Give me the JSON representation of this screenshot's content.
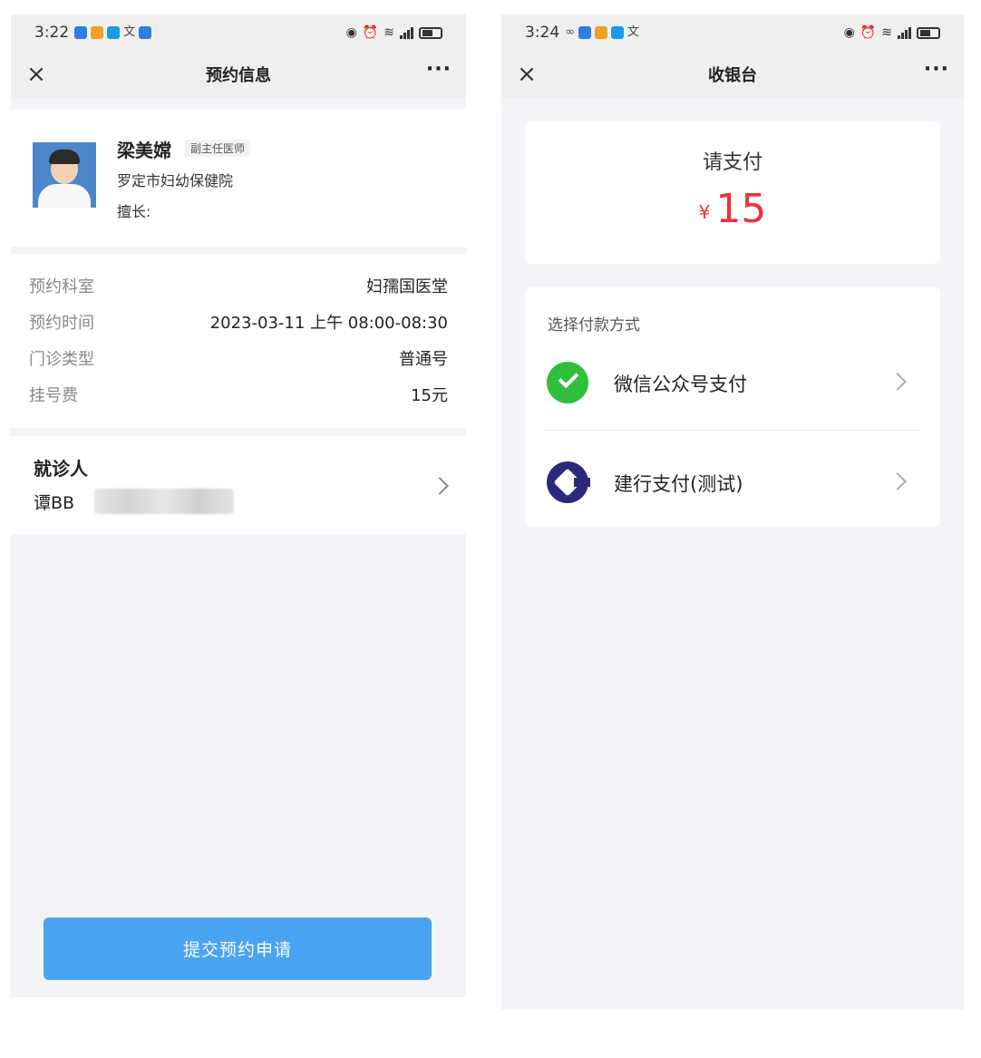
{
  "left": {
    "status": {
      "time": "3:22"
    },
    "navbar": {
      "title": "预约信息",
      "more": "···"
    },
    "doctor": {
      "name": "梁美嫦",
      "title": "副主任医师",
      "hospital": "罗定市妇幼保健院",
      "specialty": "擅长:"
    },
    "info": [
      {
        "label": "预约科室",
        "value": "妇孺国医堂"
      },
      {
        "label": "预约时间",
        "value": "2023-03-11 上午 08:00-08:30"
      },
      {
        "label": "门诊类型",
        "value": "普通号"
      },
      {
        "label": "挂号费",
        "value": "15元"
      }
    ],
    "patient": {
      "heading": "就诊人",
      "name": "谭BB"
    },
    "submit_label": "提交预约申请"
  },
  "right": {
    "status": {
      "time": "3:24"
    },
    "navbar": {
      "title": "收银台",
      "more": "···"
    },
    "payment": {
      "label": "请支付",
      "currency": "¥",
      "amount": "15"
    },
    "methods": {
      "heading": "选择付款方式",
      "items": [
        {
          "label": "微信公众号支付",
          "icon": "wechat-pay-icon"
        },
        {
          "label": "建行支付(测试)",
          "icon": "ccb-icon"
        }
      ]
    }
  },
  "colors": {
    "accent_blue": "#4aa3f0",
    "amount_red": "#e8333a",
    "wechat_green": "#2fbf3a",
    "ccb_navy": "#2b2a7a"
  }
}
